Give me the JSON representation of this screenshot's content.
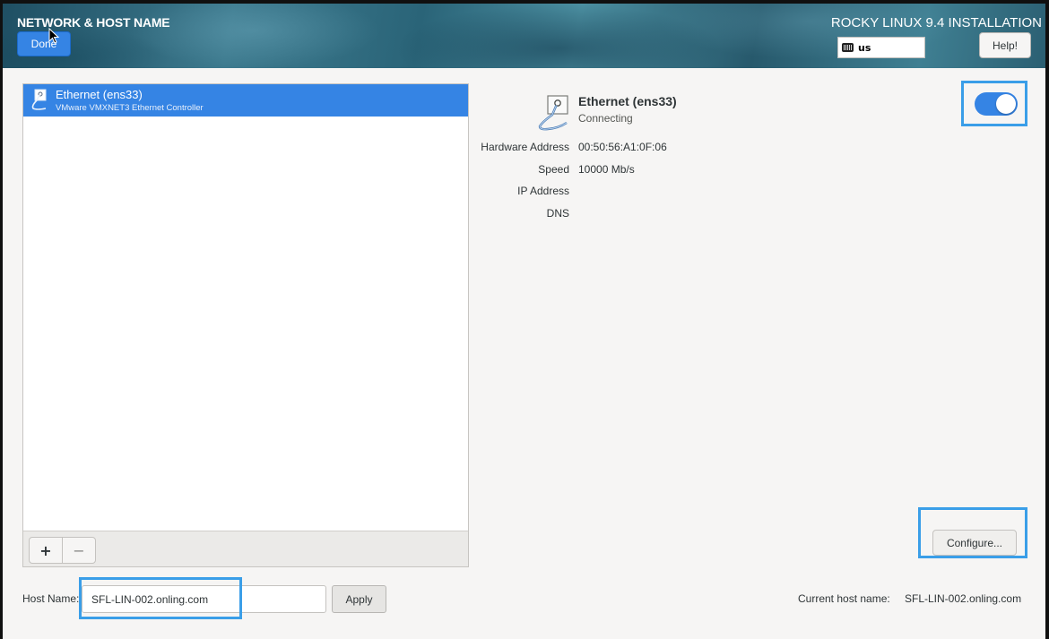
{
  "header": {
    "title": "NETWORK & HOST NAME",
    "done_label": "Done",
    "product": "ROCKY LINUX 9.4 INSTALLATION",
    "keyboard_layout": "us",
    "help_label": "Help!"
  },
  "device_list": {
    "items": [
      {
        "name": "Ethernet (ens33)",
        "description": "VMware VMXNET3 Ethernet Controller",
        "selected": true,
        "icon": "ethernet-icon"
      }
    ],
    "add_label": "+",
    "remove_label": "−"
  },
  "detail": {
    "name": "Ethernet (ens33)",
    "status": "Connecting",
    "icon": "ethernet-icon",
    "enabled": true,
    "properties": [
      {
        "label": "Hardware Address",
        "value": "00:50:56:A1:0F:06"
      },
      {
        "label": "Speed",
        "value": "10000 Mb/s"
      },
      {
        "label": "IP Address",
        "value": ""
      },
      {
        "label": "DNS",
        "value": ""
      }
    ],
    "configure_label": "Configure..."
  },
  "hostname": {
    "label": "Host Name:",
    "value": "SFL-LIN-002.onling.com",
    "apply_label": "Apply",
    "current_label": "Current host name:",
    "current_value": "SFL-LIN-002.onling.com"
  },
  "colors": {
    "accent": "#3584e4",
    "highlight": "#3a9ee8"
  }
}
